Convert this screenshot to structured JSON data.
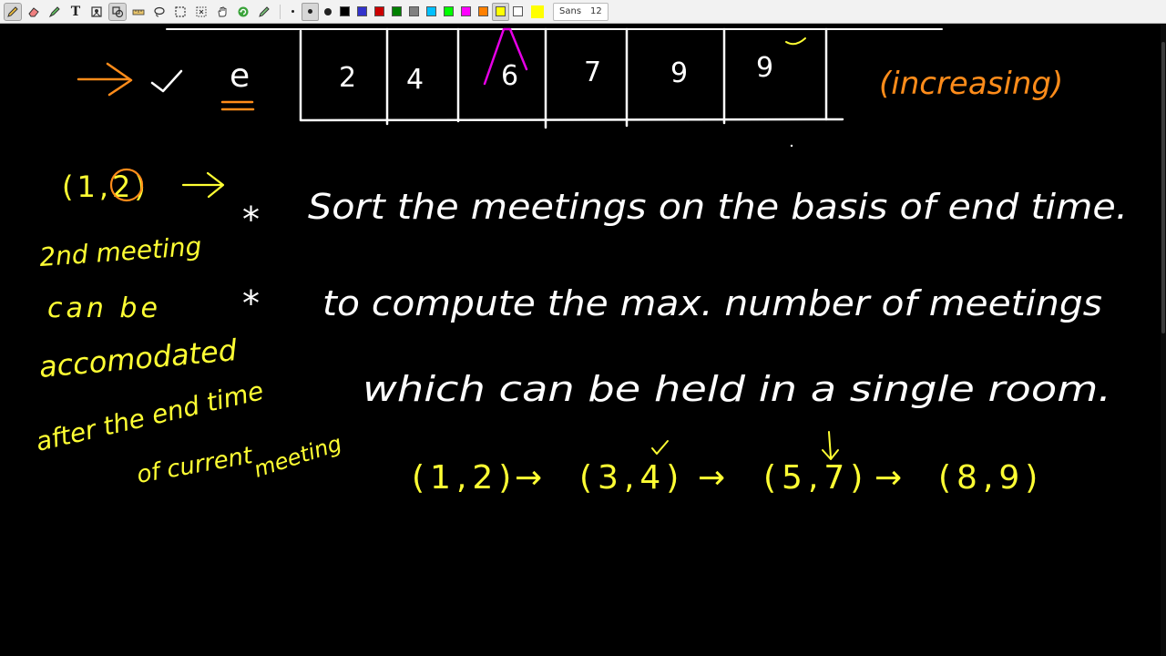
{
  "toolbar": {
    "tools": [
      {
        "name": "pen-tool",
        "icon": "pen-icon",
        "active": true
      },
      {
        "name": "eraser-tool",
        "icon": "eraser-icon"
      },
      {
        "name": "highlighter-tool",
        "icon": "highlighter-icon"
      },
      {
        "name": "text-tool",
        "icon": "text-icon"
      },
      {
        "name": "image-tool",
        "icon": "image-icon"
      },
      {
        "name": "shape-tool",
        "icon": "shape-recognizer-icon",
        "active": true
      },
      {
        "name": "ruler-tool",
        "icon": "ruler-icon"
      },
      {
        "name": "lasso-tool",
        "icon": "lasso-icon"
      },
      {
        "name": "rect-select-tool",
        "icon": "rect-select-icon"
      },
      {
        "name": "region-select-tool",
        "icon": "region-select-icon"
      },
      {
        "name": "hand-tool",
        "icon": "hand-icon"
      },
      {
        "name": "undo-tool",
        "icon": "undo-icon"
      },
      {
        "name": "default-pen-tool",
        "icon": "default-pen-icon"
      }
    ],
    "thickness": [
      "fine",
      "medium",
      "thick"
    ],
    "thickness_selected": "medium",
    "colors": [
      "#000000",
      "#3333cc",
      "#cc0000",
      "#008000",
      "#808080",
      "#00c0ff",
      "#00ff00",
      "#ff00ff",
      "#ff8000",
      "#ffff00",
      "#ffffff"
    ],
    "color_selected": "#ffff00",
    "current_color": "#ffff00",
    "font_name": "Sans",
    "font_size": "12"
  },
  "board": {
    "array_top_left_label": "e",
    "array_values": [
      "2",
      "4",
      "6",
      "7",
      "9",
      "9"
    ],
    "increasing_note": "(increasing)",
    "pair_start": "(1,2)",
    "side_note": [
      "2nd meeting",
      "can be",
      "accomodated",
      "after the end time",
      "of current",
      "meeting"
    ],
    "bullet_1": "Sort the meetings on the basis of end time.",
    "bullet_2_line_1": "to compute the max. number of meetings",
    "bullet_2_line_2": "which can be held in a single room.",
    "chain": [
      "(1,2)",
      "(3,4)",
      "(5,7)",
      "(8,9)"
    ],
    "chain_arrow": "→"
  },
  "colors": {
    "white_ink": "#ffffff",
    "yellow_ink": "#ffff33",
    "orange_ink": "#ff8c1a",
    "magenta_ink": "#e600e6",
    "background": "#000000"
  }
}
